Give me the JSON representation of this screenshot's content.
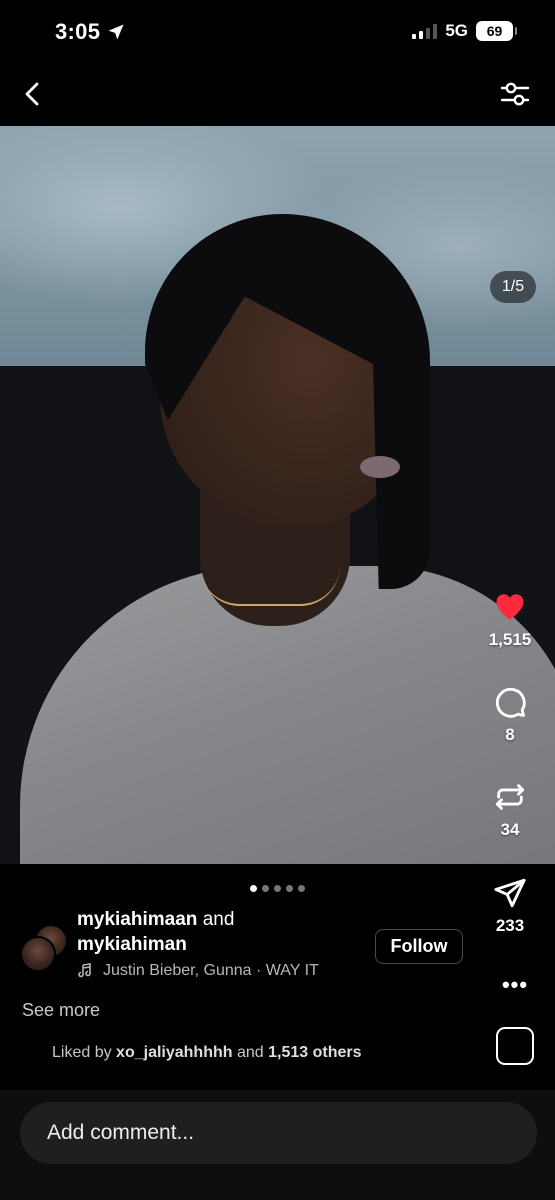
{
  "status_bar": {
    "time": "3:05",
    "network": "5G",
    "battery": "69"
  },
  "post": {
    "counter": "1/5",
    "slide_index": 1,
    "slide_total": 5
  },
  "actions": {
    "likes": "1,515",
    "comments": "8",
    "reposts": "34",
    "shares": "233"
  },
  "caption": {
    "user1": "mykiahimaan",
    "connector": "and",
    "user2": "mykiahiman",
    "music": "Justin Bieber, Gunna · WAY IT",
    "follow_label": "Follow",
    "see_more": "See more",
    "liked_prefix": "Liked by",
    "liked_user": "xo_jaliyahhhhh",
    "liked_mid": "and",
    "liked_count": "1,513 others"
  },
  "comment": {
    "placeholder": "Add comment..."
  },
  "icons": {
    "location": "location-arrow-icon",
    "back": "chevron-left-icon",
    "filter": "sliders-icon",
    "like": "heart-filled-icon",
    "comment": "comment-bubble-icon",
    "repost": "repost-icon",
    "share": "paper-plane-icon",
    "music": "music-note-icon",
    "more": "more-horizontal-icon"
  },
  "colors": {
    "like": "#ff2a3d",
    "background": "#000000"
  }
}
